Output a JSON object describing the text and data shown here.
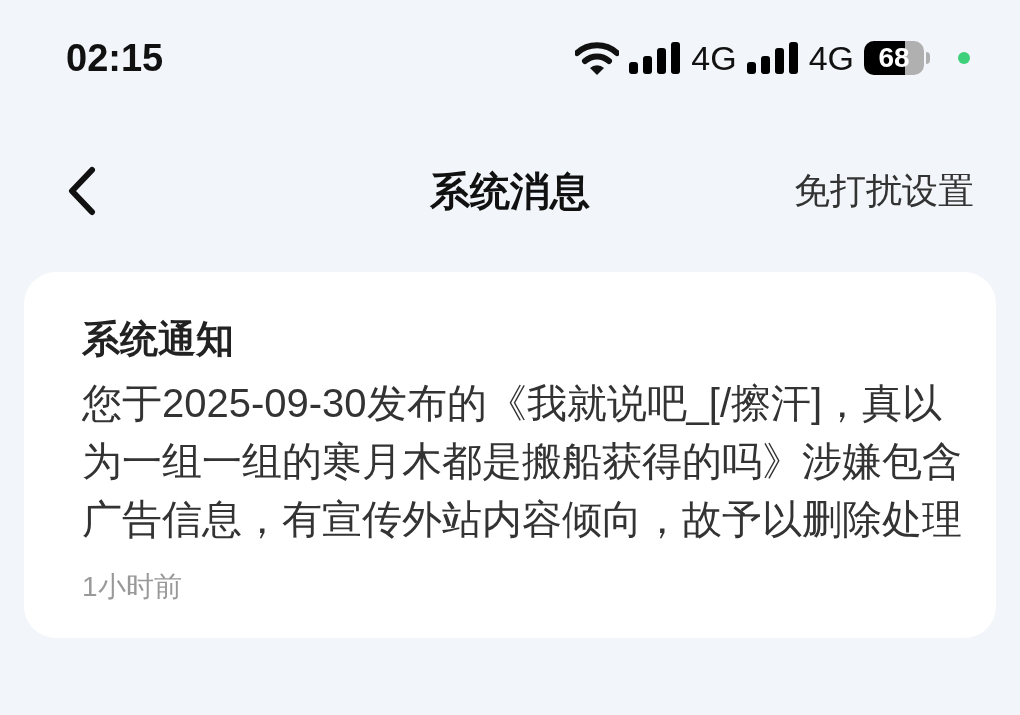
{
  "status_bar": {
    "time": "02:15",
    "network_1": "4G",
    "network_2": "4G",
    "battery": "68"
  },
  "nav": {
    "title": "系统消息",
    "action": "免打扰设置"
  },
  "notifications": [
    {
      "title": "系统通知",
      "body": "您于2025-09-30发布的《我就说吧_[/擦汗]，真以为一组一组的寒月木都是搬船获得的吗》涉嫌包含广告信息，有宣传外站内容倾向，故予以删除处理",
      "time": "1小时前"
    }
  ]
}
